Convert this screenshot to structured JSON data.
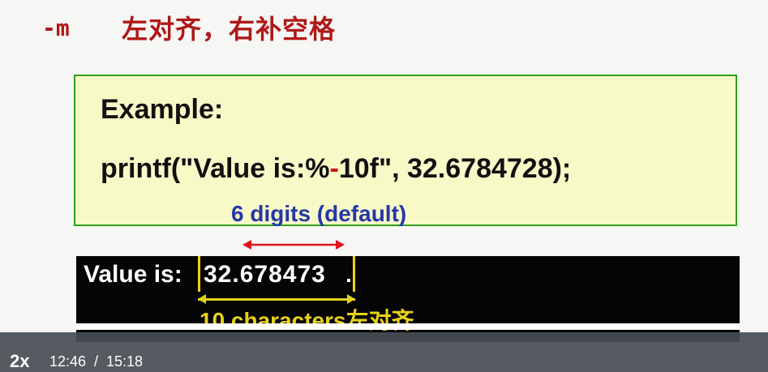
{
  "slide": {
    "flag": "-m",
    "flag_description": "左对齐，右补空格",
    "example": {
      "title": "Example:",
      "code_prefix": "printf(\"Value is:%",
      "code_minus": "-",
      "code_suffix": "10f\", 32.6784728);"
    },
    "digits_note": "6 digits (default)",
    "output": {
      "label": "Value is:",
      "value": "32.678473",
      "chars_note": "10 characters左对齐"
    }
  },
  "colors": {
    "flag_text": "#b01818",
    "example_bg": "#f7f9c6",
    "example_border": "#2f9e1f",
    "minus_highlight": "#c8181a",
    "digits_note": "#2637a8",
    "arrow": "#e0141c",
    "output_bg": "#050505",
    "bracket": "#e7d21b"
  },
  "player": {
    "speed": "2x",
    "current_time": "12:46",
    "separator": "/",
    "total_time": "15:18"
  }
}
